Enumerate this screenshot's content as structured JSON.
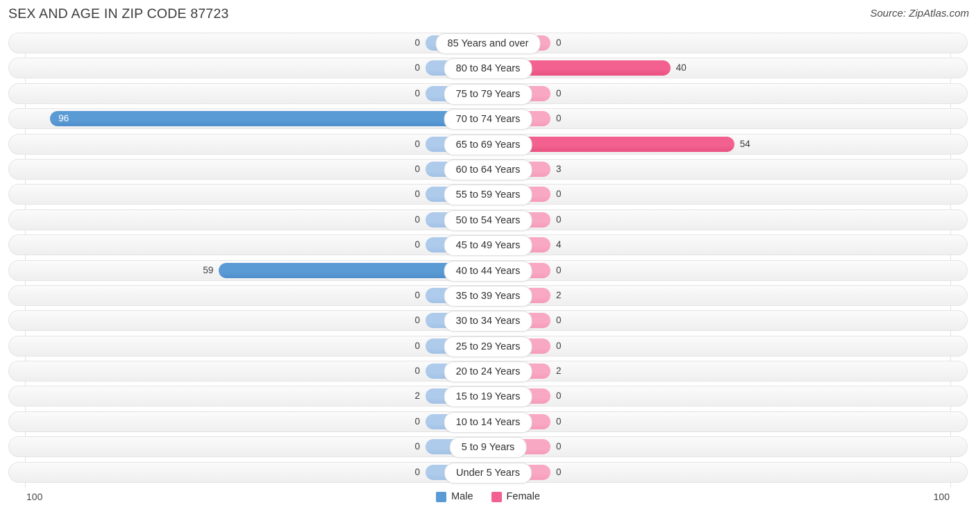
{
  "header": {
    "title": "SEX AND AGE IN ZIP CODE 87723",
    "source": "Source: ZipAtlas.com"
  },
  "axis": {
    "left_end_label": "100",
    "right_end_label": "100"
  },
  "legend": {
    "male_label": "Male",
    "female_label": "Female"
  },
  "colors": {
    "male": "#5b9bd5",
    "female": "#f2618f",
    "male_light": "#aecbeb",
    "female_light": "#f9a8c4",
    "track": "#f4f4f4",
    "track_border": "#e4e4e4"
  },
  "chart_data": {
    "type": "bar",
    "subtype": "population-pyramid",
    "title": "SEX AND AGE IN ZIP CODE 87723",
    "source": "Source: ZipAtlas.com",
    "orientation": "horizontal-diverging",
    "xlabel": "",
    "ylabel": "",
    "xlim": [
      100,
      100
    ],
    "axis_max": 100,
    "grid": false,
    "legend_position": "bottom-center",
    "categories": [
      "85 Years and over",
      "80 to 84 Years",
      "75 to 79 Years",
      "70 to 74 Years",
      "65 to 69 Years",
      "60 to 64 Years",
      "55 to 59 Years",
      "50 to 54 Years",
      "45 to 49 Years",
      "40 to 44 Years",
      "35 to 39 Years",
      "30 to 34 Years",
      "25 to 29 Years",
      "20 to 24 Years",
      "15 to 19 Years",
      "10 to 14 Years",
      "5 to 9 Years",
      "Under 5 Years"
    ],
    "series": [
      {
        "name": "Male",
        "side": "left",
        "color": "#5b9bd5",
        "values": [
          0,
          0,
          0,
          96,
          0,
          0,
          0,
          0,
          0,
          59,
          0,
          0,
          0,
          0,
          2,
          0,
          0,
          0
        ]
      },
      {
        "name": "Female",
        "side": "right",
        "color": "#f2618f",
        "values": [
          0,
          40,
          0,
          0,
          54,
          3,
          0,
          0,
          4,
          0,
          2,
          0,
          0,
          2,
          0,
          0,
          0,
          0
        ]
      }
    ]
  }
}
